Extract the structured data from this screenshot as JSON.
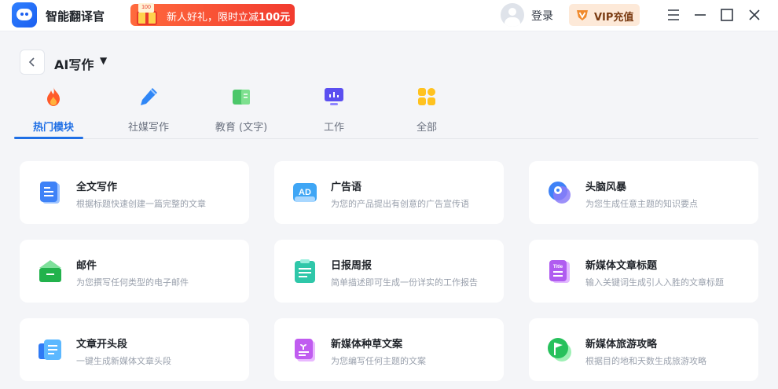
{
  "titlebar": {
    "app_name": "智能翻译官",
    "promo_tag": "100",
    "promo_prefix": "新人好礼，限时立减",
    "promo_amount": "100元",
    "login": "登录",
    "vip": "VIP充值"
  },
  "header": {
    "title": "AI写作"
  },
  "tabs": [
    {
      "label": "热门模块",
      "icon": "flame-icon",
      "active": true
    },
    {
      "label": "社媒写作",
      "icon": "pencil-icon",
      "active": false
    },
    {
      "label": "教育 (文字)",
      "icon": "book-icon",
      "active": false
    },
    {
      "label": "工作",
      "icon": "monitor-icon",
      "active": false
    },
    {
      "label": "全部",
      "icon": "grid-icon",
      "active": false
    }
  ],
  "cards": [
    {
      "title": "全文写作",
      "desc": "根据标题快速创建一篇完整的文章",
      "icon": "document-icon"
    },
    {
      "title": "广告语",
      "desc": "为您的产品提出有创意的广告宣传语",
      "icon": "ad-icon"
    },
    {
      "title": "头脑风暴",
      "desc": "为您生成任意主题的知识要点",
      "icon": "brain-icon"
    },
    {
      "title": "邮件",
      "desc": "为您撰写任何类型的电子邮件",
      "icon": "mail-icon"
    },
    {
      "title": "日报周报",
      "desc": "简单描述即可生成一份详实的工作报告",
      "icon": "clipboard-icon"
    },
    {
      "title": "新媒体文章标题",
      "desc": "输入关键词生成引人入胜的文章标题",
      "icon": "title-doc-icon"
    },
    {
      "title": "文章开头段",
      "desc": "一键生成新媒体文章头段",
      "icon": "paragraph-icon"
    },
    {
      "title": "新媒体种草文案",
      "desc": "为您编写任何主题的文案",
      "icon": "sprout-icon"
    },
    {
      "title": "新媒体旅游攻略",
      "desc": "根据目的地和天数生成旅游攻略",
      "icon": "flag-icon"
    }
  ],
  "colors": {
    "accent": "#1f6fe5",
    "promo": "#f23b2f",
    "vip_bg": "#fde9d8"
  }
}
